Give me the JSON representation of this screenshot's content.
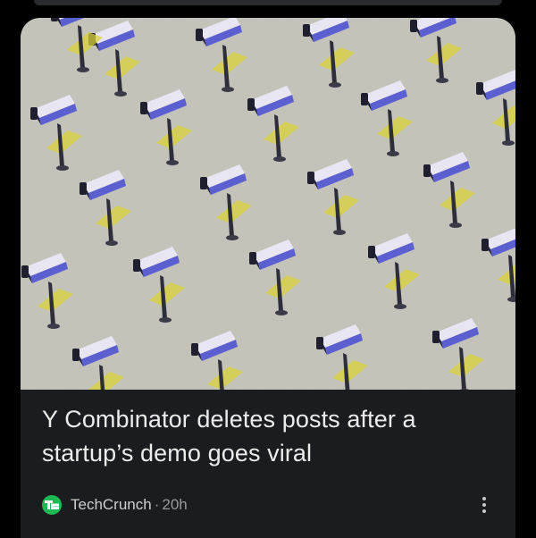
{
  "article": {
    "headline": "Y Combinator deletes posts after a startup’s demo goes viral",
    "source": "TechCrunch",
    "separator": "·",
    "age": "20h"
  },
  "hero_image": {
    "subject": "rows of security cameras on a textured gray surface",
    "colors": {
      "background": "#c8c8bd",
      "camera_body": "#5b5fd0",
      "camera_highlight": "#e9e6f4",
      "shadow_tint": "#d9d23a"
    }
  },
  "icons": {
    "source_logo": "techcrunch-logo",
    "menu": "more-vert-icon"
  },
  "theme": {
    "card_background": "#1b1c1f",
    "headline_color": "#ececec",
    "meta_color": "#9a9a9a",
    "logo_green": "#1db954"
  }
}
